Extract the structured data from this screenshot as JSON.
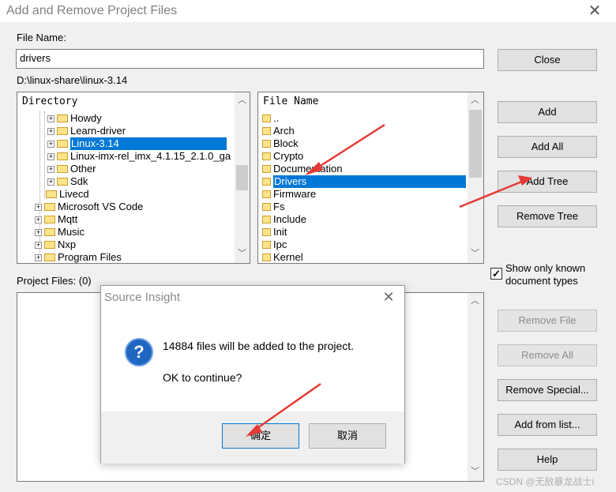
{
  "window": {
    "title": "Add and Remove Project Files"
  },
  "file_name": {
    "label": "File Name:",
    "value": "drivers"
  },
  "current_path": "D:\\linux-share\\linux-3.14",
  "directory_list": {
    "header": "Directory",
    "items": [
      {
        "label": "Howdy",
        "expander": "+"
      },
      {
        "label": "Learn-driver",
        "expander": "+"
      },
      {
        "label": "Linux-3.14",
        "expander": "+",
        "selected": true
      },
      {
        "label": "Linux-imx-rel_imx_4.1.15_2.1.0_ga",
        "expander": "+"
      },
      {
        "label": "Other",
        "expander": "+"
      },
      {
        "label": "Sdk",
        "expander": "+"
      },
      {
        "label": "Livecd",
        "expander": ""
      },
      {
        "label": "Microsoft VS Code",
        "expander": "+"
      },
      {
        "label": "Mqtt",
        "expander": "+"
      },
      {
        "label": "Music",
        "expander": "+"
      },
      {
        "label": "Nxp",
        "expander": "+"
      },
      {
        "label": "Program Files",
        "expander": "+"
      }
    ]
  },
  "file_list": {
    "header": "File Name",
    "items": [
      {
        "label": "..",
        "selected": false
      },
      {
        "label": "Arch",
        "selected": false
      },
      {
        "label": "Block",
        "selected": false
      },
      {
        "label": "Crypto",
        "selected": false
      },
      {
        "label": "Documentation",
        "selected": false
      },
      {
        "label": "Drivers",
        "selected": true
      },
      {
        "label": "Firmware",
        "selected": false
      },
      {
        "label": "Fs",
        "selected": false
      },
      {
        "label": "Include",
        "selected": false
      },
      {
        "label": "Init",
        "selected": false
      },
      {
        "label": "Ipc",
        "selected": false
      },
      {
        "label": "Kernel",
        "selected": false
      }
    ]
  },
  "project_files": {
    "label": "Project Files: (0)"
  },
  "buttons": {
    "close": "Close",
    "add": "Add",
    "add_all": "Add All",
    "add_tree": "Add Tree",
    "remove_tree": "Remove Tree",
    "remove_file": "Remove File",
    "remove_all": "Remove All",
    "remove_special": "Remove Special...",
    "add_from_list": "Add from list...",
    "help": "Help"
  },
  "show_known_types": {
    "label_line1": "Show only known",
    "label_line2": "document types",
    "checked": true,
    "check_glyph": "✓"
  },
  "dialog": {
    "title": "Source Insight",
    "message": "14884 files will be added to the project.",
    "question": "OK to continue?",
    "ok_label": "确定",
    "cancel_label": "取消",
    "icon": "question-icon"
  },
  "watermark": "CSDN @无敌暴龙战士i",
  "annotation_color": "#e53935"
}
